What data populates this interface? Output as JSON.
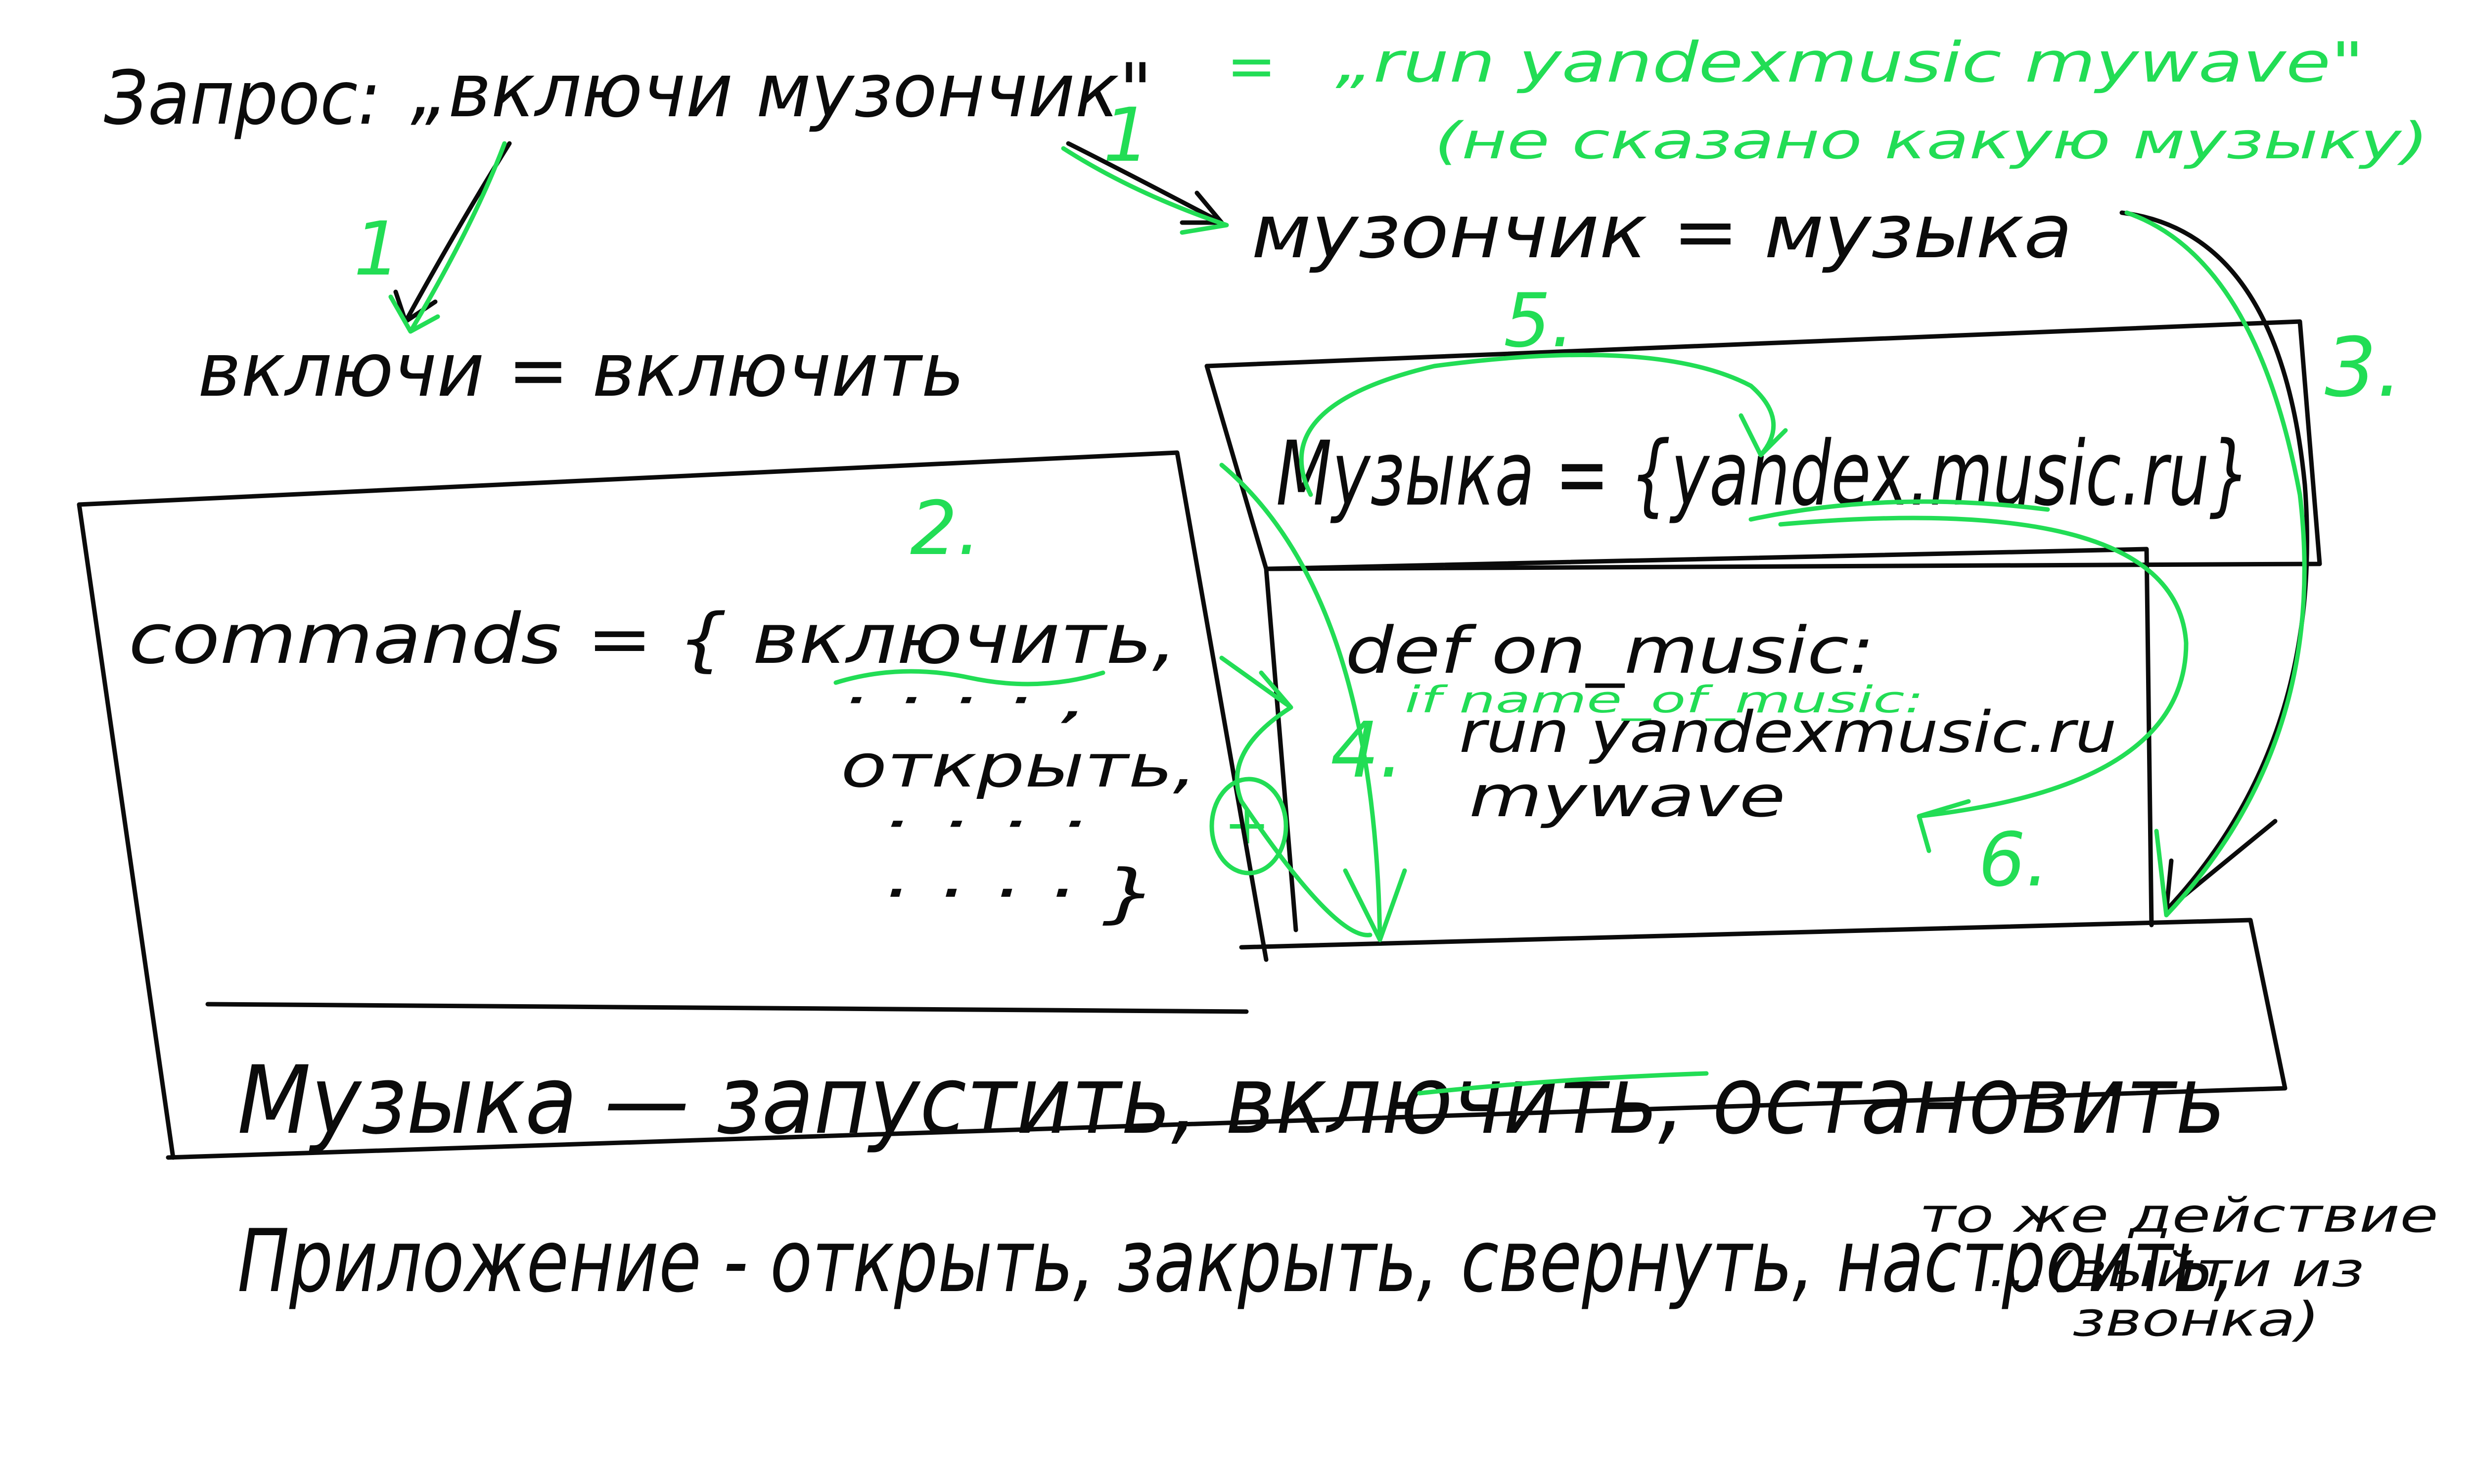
{
  "colors": {
    "ink": "#0b0b0b",
    "accent": "#22dd55",
    "background": "#ffffff"
  },
  "request": {
    "label": "Запрос:",
    "phrase": "„включи музончик\"",
    "equals": "=",
    "translation": "„run yandexmusic mywave\"",
    "note": "(не сказано какую музыку)"
  },
  "definitions": {
    "verb": "включи = включить",
    "noun": "музончик = музыка"
  },
  "commands_box": {
    "line1": "commands = { включить,",
    "dots1": "· · · · ,",
    "line2": "открыть,",
    "dots2": "· · · ·",
    "line3": "· · · · }"
  },
  "music_box": {
    "header": "Музыка = {yandex.music.ru}",
    "def_line": "def on_music:",
    "if_line": "if name_of_music:",
    "run_line": "run yandexmusic.ru",
    "mywave_line": "mywave"
  },
  "verbs_row": {
    "text": "Музыка — запустить, включить, остановить"
  },
  "app_row": {
    "text": "Приложение - открыть, закрыть, свернуть, настроить,",
    "tail1": "то же действие",
    "tail2": "...(выйти из",
    "tail3": "звонка)"
  },
  "step_labels": {
    "s1a": "1",
    "s1b": "1",
    "s2": "2.",
    "s3": "3.",
    "s4": "4.",
    "s5": "5.",
    "s6": "6.",
    "plus": "+"
  }
}
